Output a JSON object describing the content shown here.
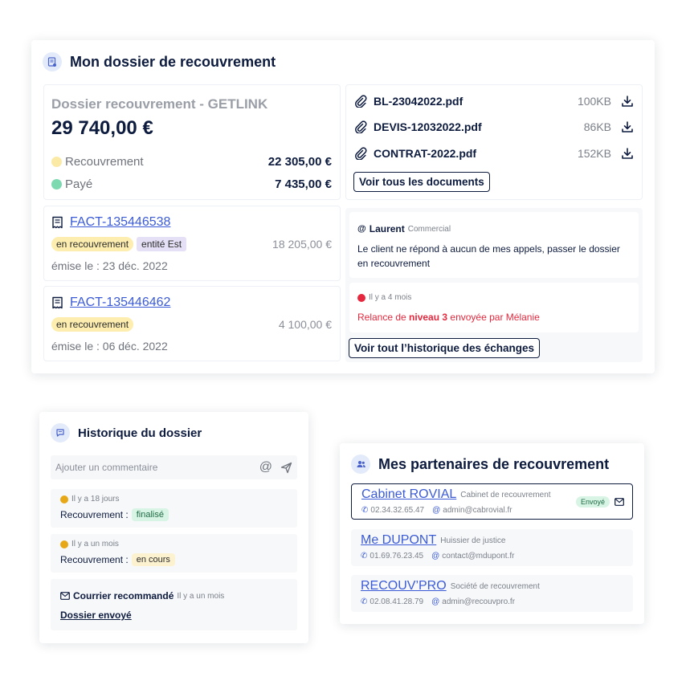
{
  "dossier": {
    "title": "Mon dossier de recouvrement",
    "summary": {
      "name": "Dossier recouvrement - GETLINK",
      "total": "29 740,00 €",
      "lines": [
        {
          "label": "Recouvrement",
          "value": "22 305,00 €",
          "color": "#fbeaa6"
        },
        {
          "label": "Payé",
          "value": "7 435,00 €",
          "color": "#7dd9b0"
        }
      ]
    },
    "documents": [
      {
        "name": "BL-23042022.pdf",
        "size": "100KB"
      },
      {
        "name": "DEVIS-12032022.pdf",
        "size": "86KB"
      },
      {
        "name": "CONTRAT-2022.pdf",
        "size": "152KB"
      }
    ],
    "documents_button": "Voir tous les documents",
    "invoices": [
      {
        "ref": "FACT-135446538",
        "chips": [
          "en recouvrement",
          "entité Est"
        ],
        "amount": "18 205,00 €",
        "date": "émise le : 23 déc. 2022"
      },
      {
        "ref": "FACT-135446462",
        "chips": [
          "en recouvrement"
        ],
        "amount": "4 100,00 €",
        "date": "émise le : 06 déc. 2022"
      }
    ],
    "comment": {
      "at": "@",
      "author": "Laurent",
      "role": "Commercial",
      "text": "Le client ne répond à aucun de mes appels, passer le dossier en recouvrement"
    },
    "event": {
      "time": "Il y a 4 mois",
      "text_before": "Relance de ",
      "text_bold": "niveau 3",
      "text_after": " envoyée par Mélanie",
      "color": "#e5283d"
    },
    "history_button": "Voir tout l’historique des échanges"
  },
  "historique": {
    "title": "Historique du dossier",
    "comment_placeholder": "Ajouter un commentaire",
    "items": [
      {
        "time": "Il y a 18 jours",
        "label": "Recouvrement :",
        "chip": "finalisé"
      },
      {
        "time": "Il y a un mois",
        "label": "Recouvrement :",
        "chip": "en cours"
      }
    ],
    "courrier": {
      "title": "Courrier recommandé",
      "time": "Il y a un mois",
      "link": "Dossier envoyé"
    }
  },
  "partenaires": {
    "title": "Mes partenaires de recouvrement",
    "items": [
      {
        "name": "Cabinet ROVIAL",
        "role": "Cabinet de recouvrement",
        "phone": "02.34.32.65.47",
        "email": "admin@cabrovial.fr",
        "badge": "Envoyé"
      },
      {
        "name": "Me DUPONT",
        "role": "Huissier de justice",
        "phone": "01.69.76.23.45",
        "email": "contact@mdupont.fr"
      },
      {
        "name": "RECOUV’PRO",
        "role": "Société de recouvrement",
        "phone": "02.08.41.28.79",
        "email": "admin@recouvpro.fr"
      }
    ]
  }
}
